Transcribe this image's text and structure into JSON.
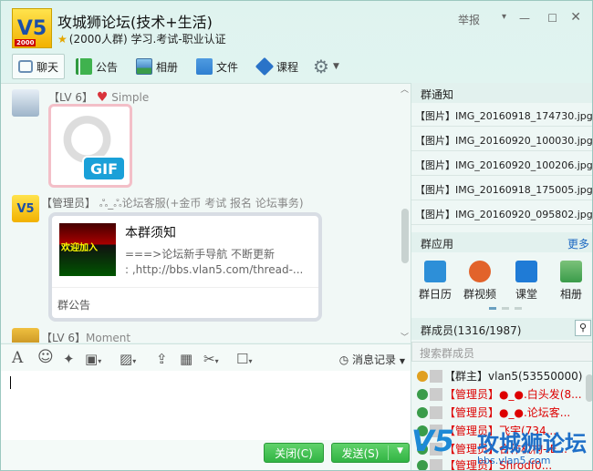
{
  "header": {
    "logo": "V5",
    "logo_year": "2000",
    "title": "攻城狮论坛(技术+生活)",
    "subtitle": "(2000人群) 学习.考试-职业认证",
    "report": "举报",
    "dropdown": "▾",
    "minimize": "—",
    "maximize": "☐",
    "close": "✕"
  },
  "tabs": [
    {
      "label": "聊天",
      "icon": "chat-icon",
      "color": "#6a8fb5"
    },
    {
      "label": "公告",
      "icon": "announcement-flag-icon",
      "color": "#2f9a3f"
    },
    {
      "label": "相册",
      "icon": "album-image-icon",
      "color": "#4b8ac8"
    },
    {
      "label": "文件",
      "icon": "folder-icon",
      "color": "#2f7fd0"
    },
    {
      "label": "课程",
      "icon": "course-play-icon",
      "color": "#2a73c8"
    }
  ],
  "messages": {
    "m1_level": "【LV 6】",
    "m1_name": "Simple",
    "gif_label": "GIF",
    "m2_level": "【管理员】",
    "m2_name": "ஃ_ஃ论坛客服(+金币 考试 报名 论坛事务)",
    "card_thumb_text": "欢迎加入",
    "card_title": "本群须知",
    "card_line1": "===>论坛新手导航 不断更新",
    "card_line2": ": ,http://bbs.vlan5.com/thread-...",
    "card_footer": "群公告",
    "m3_level": "【LV 6】",
    "m3_name": "Moment"
  },
  "input_toolbar": {
    "font": "A",
    "emoji": "☺",
    "history": "消息记录"
  },
  "buttons": {
    "close": "关闭(C)",
    "send": "发送(S)"
  },
  "right_panel": {
    "notice_header": "群通知",
    "files": [
      "【图片】IMG_20160918_174730.jpg",
      "【图片】IMG_20160920_100030.jpg",
      "【图片】IMG_20160920_100206.jpg",
      "【图片】IMG_20160918_175005.jpg",
      "【图片】IMG_20160920_095802.jpg"
    ],
    "apps_header": "群应用",
    "apps_more": "更多",
    "apps": [
      {
        "label": "群日历",
        "icon": "calendar-icon",
        "color": "#2d8fd8"
      },
      {
        "label": "群视频",
        "icon": "video-icon",
        "color": "#e2632b"
      },
      {
        "label": "课堂",
        "icon": "classroom-icon",
        "color": "#1f7bd6"
      },
      {
        "label": "相册",
        "icon": "photo-icon",
        "color": "#3a9c4a"
      }
    ],
    "members_header": "群成员(1316/1987)",
    "members_search": "搜索群成员",
    "members": [
      {
        "role": "【群主】",
        "name": "vlan5(53550000)"
      },
      {
        "role": "【管理员】",
        "name": "●_●.白头发(8..."
      },
      {
        "role": "【管理员】",
        "name": "●_●.论坛客..."
      },
      {
        "role": "【管理员】",
        "name": "飞宇(734..."
      },
      {
        "role": "【管理员】",
        "name": "合作机构-IE..."
      },
      {
        "role": "【管理员】",
        "name": "Shrodf0..."
      }
    ]
  },
  "watermark": {
    "logo": "V5",
    "name": "攻城狮论坛",
    "url": "bbs.vlan5.com"
  }
}
